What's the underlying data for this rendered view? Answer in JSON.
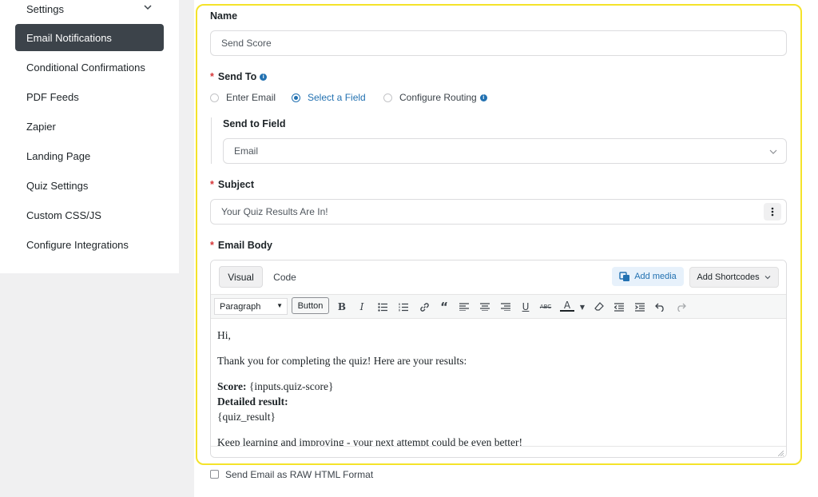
{
  "sidebar": {
    "items": [
      {
        "label": "Settings"
      },
      {
        "label": "Email Notifications"
      },
      {
        "label": "Conditional Confirmations"
      },
      {
        "label": "PDF Feeds"
      },
      {
        "label": "Zapier"
      },
      {
        "label": "Landing Page"
      },
      {
        "label": "Quiz Settings"
      },
      {
        "label": "Custom CSS/JS"
      },
      {
        "label": "Configure Integrations"
      }
    ]
  },
  "form": {
    "name_label": "Name",
    "name_value": "Send Score",
    "send_to_label": "Send To",
    "send_to_options": [
      {
        "label": "Enter Email",
        "selected": false
      },
      {
        "label": "Select a Field",
        "selected": true
      },
      {
        "label": "Configure Routing",
        "selected": false
      }
    ],
    "send_to_field_label": "Send to Field",
    "send_to_field_value": "Email",
    "subject_label": "Subject",
    "subject_value": "Your Quiz Results Are In!",
    "email_body_label": "Email Body",
    "required_mark": "*",
    "info_mark": "i"
  },
  "editor": {
    "tab_visual": "Visual",
    "tab_code": "Code",
    "add_media": "Add media",
    "add_shortcodes": "Add Shortcodes",
    "format_select": "Paragraph",
    "button_label": "Button",
    "body": {
      "line1": "Hi,",
      "line2": "Thank you for completing the quiz! Here are your results:",
      "score_label": "Score:",
      "score_value": " {inputs.quiz-score}",
      "detailed_label": "Detailed result:",
      "detailed_value": "{quiz_result}",
      "line_last": "Keep learning and improving - your next attempt could be even better!"
    },
    "toolbar_icons": [
      "bold-icon",
      "italic-icon",
      "bullet-list-icon",
      "numbered-list-icon",
      "link-icon",
      "blockquote-icon",
      "align-left-icon",
      "align-center-icon",
      "align-right-icon",
      "underline-icon",
      "strikethrough-icon",
      "text-color-icon",
      "clear-format-icon",
      "outdent-icon",
      "indent-icon",
      "undo-icon",
      "redo-icon"
    ]
  },
  "raw_html_label": "Send Email as RAW HTML Format",
  "colors": {
    "accent": "#2271b1",
    "highlight": "#f4e32a",
    "active_nav": "#3c434a"
  }
}
